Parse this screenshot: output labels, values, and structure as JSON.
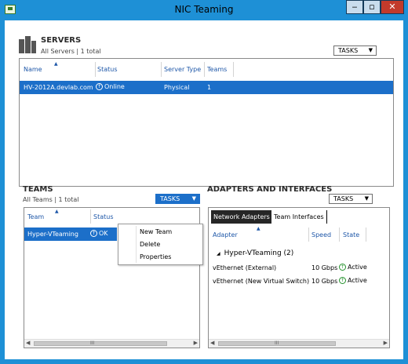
{
  "window": {
    "title": "NIC Teaming"
  },
  "servers": {
    "heading": "SERVERS",
    "subtitle": "All Servers | 1 total",
    "tasks_label": "TASKS",
    "columns": [
      "Name",
      "Status",
      "Server Type",
      "Teams"
    ],
    "rows": [
      {
        "name": "HV-2012A.devlab.com",
        "status": "Online",
        "server_type": "Physical",
        "teams": "1"
      }
    ]
  },
  "teams": {
    "heading": "TEAMS",
    "subtitle": "All Teams | 1 total",
    "tasks_label": "TASKS",
    "columns": [
      "Team",
      "Status"
    ],
    "rows": [
      {
        "team": "Hyper-VTeaming",
        "status": "OK"
      }
    ],
    "menu": [
      "New Team",
      "Delete",
      "Properties"
    ]
  },
  "adapters": {
    "heading": "ADAPTERS AND INTERFACES",
    "tasks_label": "TASKS",
    "tabs": [
      "Network Adapters",
      "Team Interfaces"
    ],
    "columns": [
      "Adapter",
      "Speed",
      "State"
    ],
    "group": "Hyper-VTeaming (2)",
    "rows": [
      {
        "adapter": "vEthernet (External)",
        "speed": "10 Gbps",
        "state": "Active"
      },
      {
        "adapter": "vEthernet (New Virtual Switch)",
        "speed": "10 Gbps",
        "state": "Active"
      }
    ]
  },
  "icons": {
    "status_up": "↑",
    "dropdown": "▼",
    "sort_up": "▲",
    "expand": "◢",
    "scroll_left": "◀",
    "scroll_right": "▶",
    "grip": "III"
  },
  "colors": {
    "titlebar": "#1e90d6",
    "selection": "#1c6fc9",
    "active_state": "#23912c",
    "column_header": "#1e57a8"
  }
}
